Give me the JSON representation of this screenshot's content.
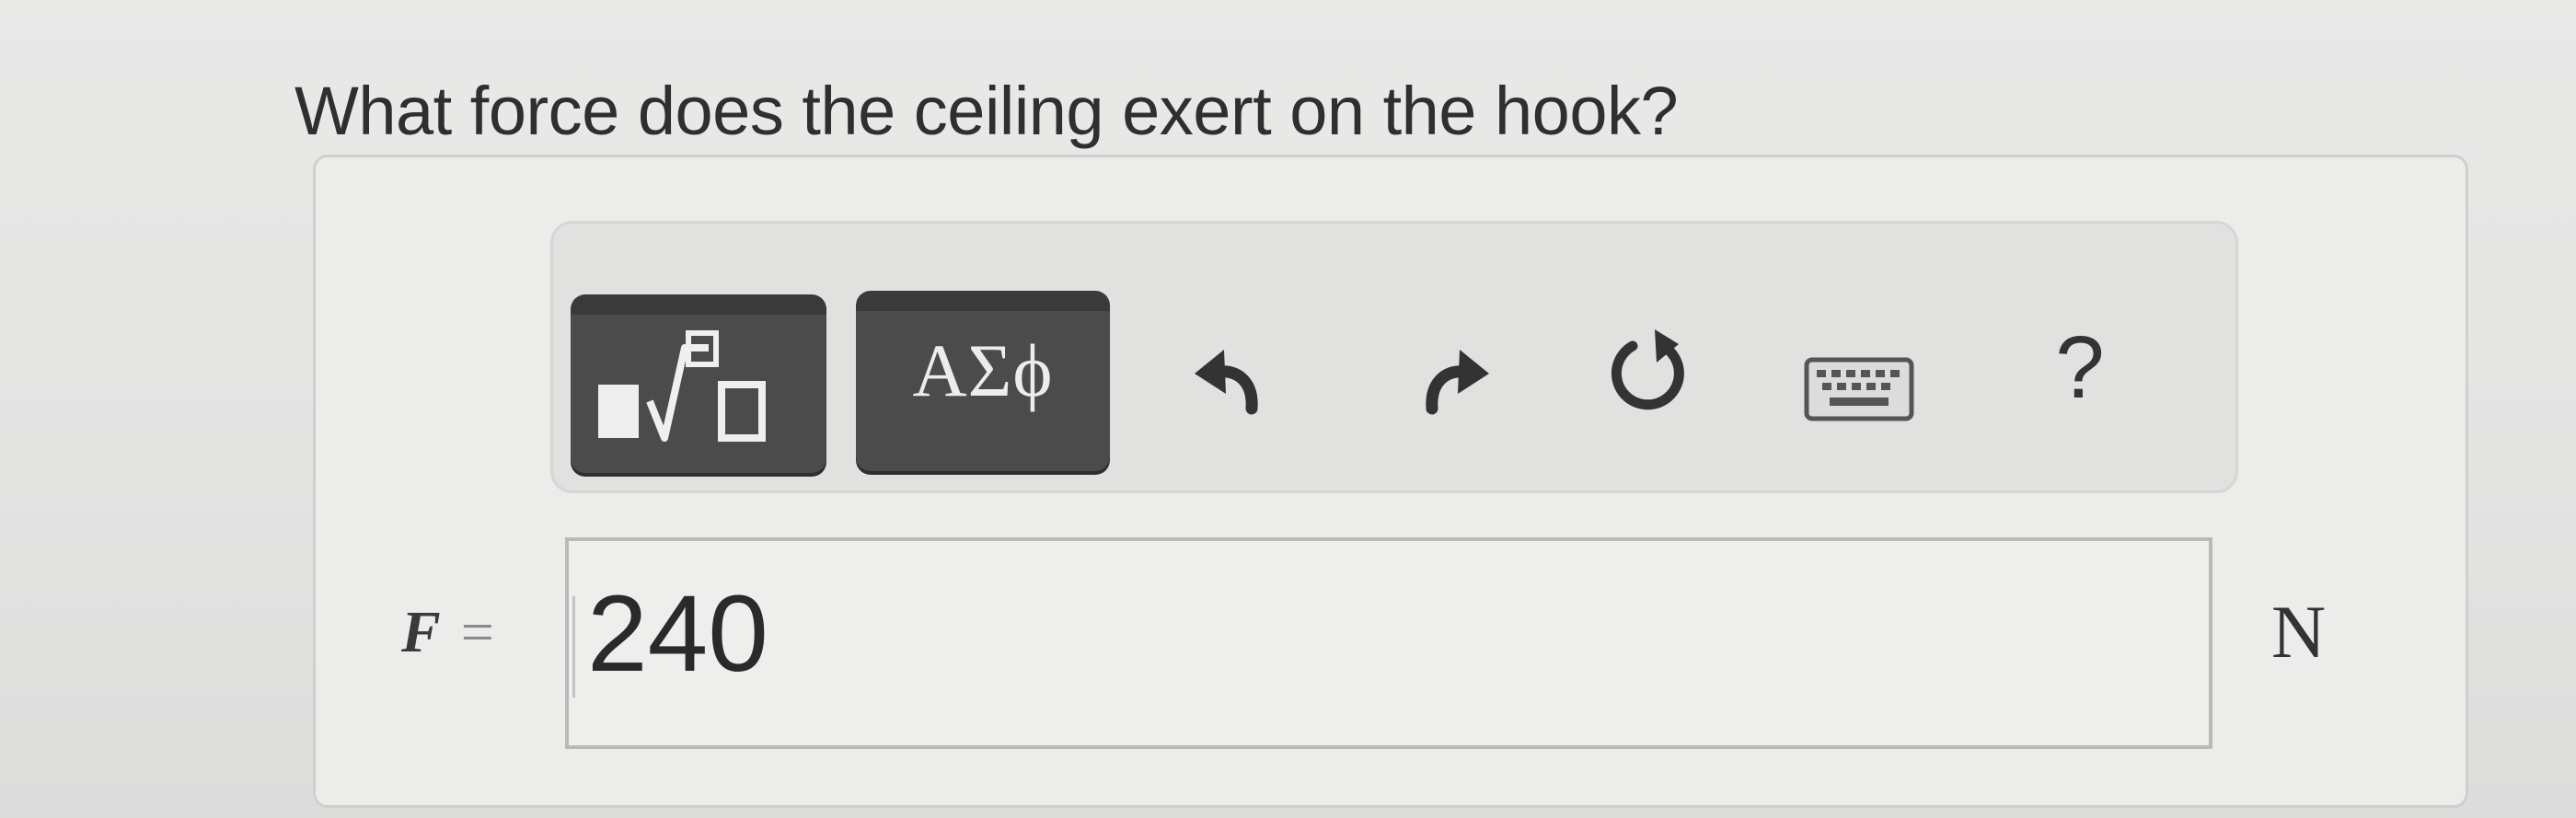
{
  "question": {
    "text": "What force does the ceiling exert on the hook?"
  },
  "toolbar": {
    "templates_icon": "fraction-root-template-icon",
    "greek_label": "ΑΣϕ",
    "undo_icon": "undo-arrow-icon",
    "redo_icon": "redo-arrow-icon",
    "reset_icon": "reset-circle-icon",
    "keyboard_icon": "keyboard-icon",
    "help_label": "?"
  },
  "answer": {
    "variable": "F",
    "equals": "=",
    "value": "240",
    "unit": "N"
  },
  "colors": {
    "dark_button": "#4b4b4b",
    "background": "#e6e6e5",
    "input_border": "#b9b9b8"
  }
}
